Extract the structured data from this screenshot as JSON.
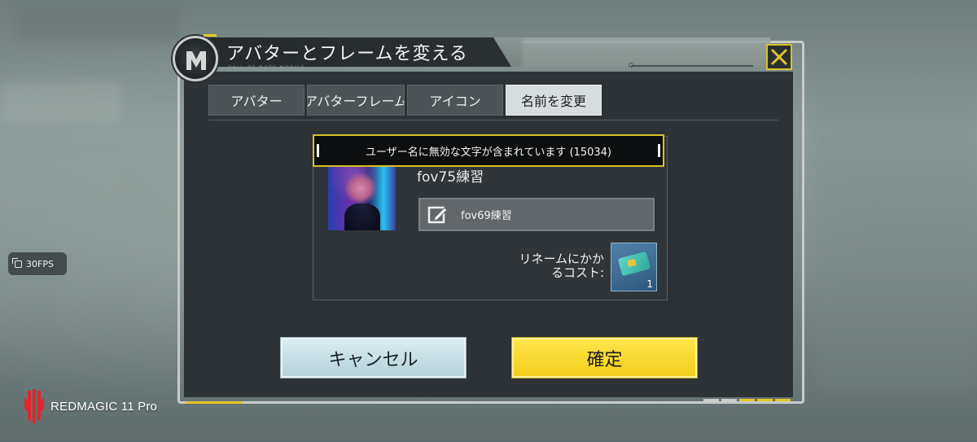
{
  "overlay": {
    "fps_label": "30FPS",
    "watermark": "REDMAGIC 11 Pro"
  },
  "dialog": {
    "title": "アバターとフレームを変える",
    "brand_caption": "CALL OF DUTY MOBILE",
    "tabs": [
      {
        "label": "アバター",
        "active": false
      },
      {
        "label": "アバターフレーム",
        "active": false
      },
      {
        "label": "アイコン",
        "active": false
      },
      {
        "label": "名前を変更",
        "active": true
      }
    ],
    "current_name": "fov75練習",
    "name_input_value": "fov69練習",
    "cost_label": "リネームにかかるコスト:",
    "cost_count": "1",
    "error_message": "ユーザー名に無効な文字が含まれています (15034)",
    "cancel_label": "キャンセル",
    "confirm_label": "確定"
  },
  "colors": {
    "accent_yellow": "#f3cf1d",
    "panel_dark": "#2c3235",
    "cancel_blue": "#c7e0e7"
  }
}
